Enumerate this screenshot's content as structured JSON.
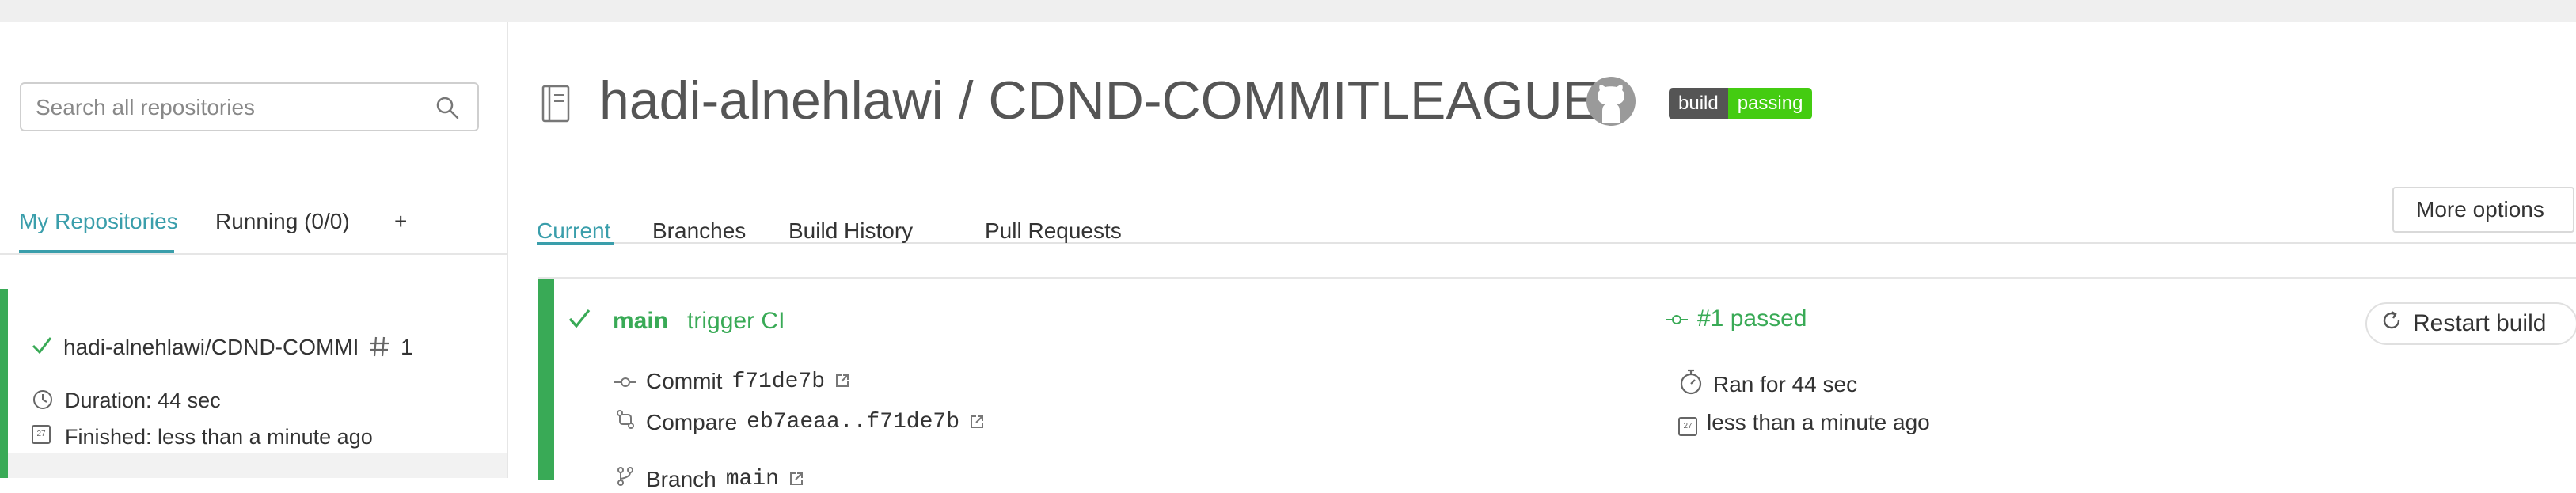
{
  "sidebar": {
    "search_placeholder": "Search all repositories",
    "tabs": [
      {
        "label": "My Repositories"
      },
      {
        "label": "Running (0/0)"
      },
      {
        "label": "+"
      }
    ],
    "repo": {
      "name": "hadi-alnehlawi/CDND-COMMI",
      "number": "1",
      "duration": "Duration: 44 sec",
      "finished": "Finished: less than a minute ago"
    }
  },
  "header": {
    "title": "hadi-alnehlawi / CDND-COMMITLEAGUE-",
    "badge_left": "build",
    "badge_right": "passing"
  },
  "tabs": [
    {
      "label": "Current"
    },
    {
      "label": "Branches"
    },
    {
      "label": "Build History"
    },
    {
      "label": "Pull Requests"
    }
  ],
  "more_options": "More options",
  "build": {
    "branch": "main",
    "message": "trigger CI",
    "status": "#1 passed",
    "commit_label": "Commit",
    "commit": "f71de7b",
    "compare_label": "Compare",
    "compare": "eb7aeaa..f71de7b",
    "branch_label": "Branch",
    "branch_name": "main",
    "ran_for": "Ran for 44 sec",
    "finished": "less than a minute ago",
    "restart": "Restart build"
  },
  "colors": {
    "accent": "#3a9eab",
    "passed": "#39aa56"
  }
}
